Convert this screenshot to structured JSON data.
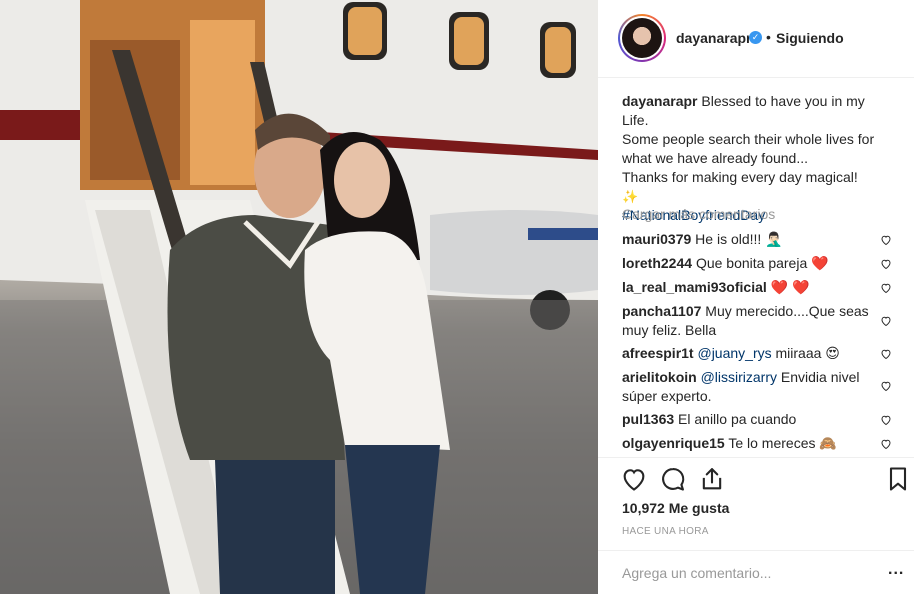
{
  "post": {
    "username": "dayanarapr",
    "verified_mark": "✓",
    "separator": "•",
    "follow_status": "Siguiendo",
    "caption": {
      "username": "dayanarapr",
      "lines": [
        "Blessed to have you in my Life.",
        "Some people search their whole lives for",
        "what we have already found...",
        "Thanks for making every day magical!"
      ],
      "emoji": "✨",
      "hashtag": "#NationalBoyfriendDay"
    },
    "load_more": "Cargar más comentarios",
    "comments": [
      {
        "user": "mauri0379",
        "text": "He is old!!! 🤦🏻‍♂️"
      },
      {
        "user": "loreth2244",
        "text": "Que bonita pareja ❤️"
      },
      {
        "user": "la_real_mami93oficial",
        "text": "❤️ ❤️"
      },
      {
        "user": "pancha1107",
        "text": "Muy merecido....Que seas muy feliz. Bella"
      },
      {
        "user": "afreespir1t",
        "mention": "@juany_rys",
        "text": "miiraaa 😍"
      },
      {
        "user": "arielitokoin",
        "mention": "@lissirizarry",
        "text": "Envidia nivel súper experto."
      },
      {
        "user": "pul1363",
        "text": "El anillo pa cuando"
      },
      {
        "user": "olgayenrique15",
        "text": "Te lo mereces 🙈"
      }
    ],
    "likes": "10,972 Me gusta",
    "timestamp": "HACE UNA HORA",
    "add_comment_placeholder": "Agrega un comentario...",
    "more_options": "..."
  },
  "icons": {
    "like": "heart-outline-icon",
    "comment": "speech-bubble-icon",
    "share": "share-arrow-icon",
    "save": "bookmark-icon",
    "comment_like": "small-heart-icon",
    "verified": "verified-badge-icon"
  },
  "colors": {
    "text": "#262626",
    "muted": "#999999",
    "link": "#003569",
    "verified": "#3897f0",
    "border": "#efefef"
  }
}
